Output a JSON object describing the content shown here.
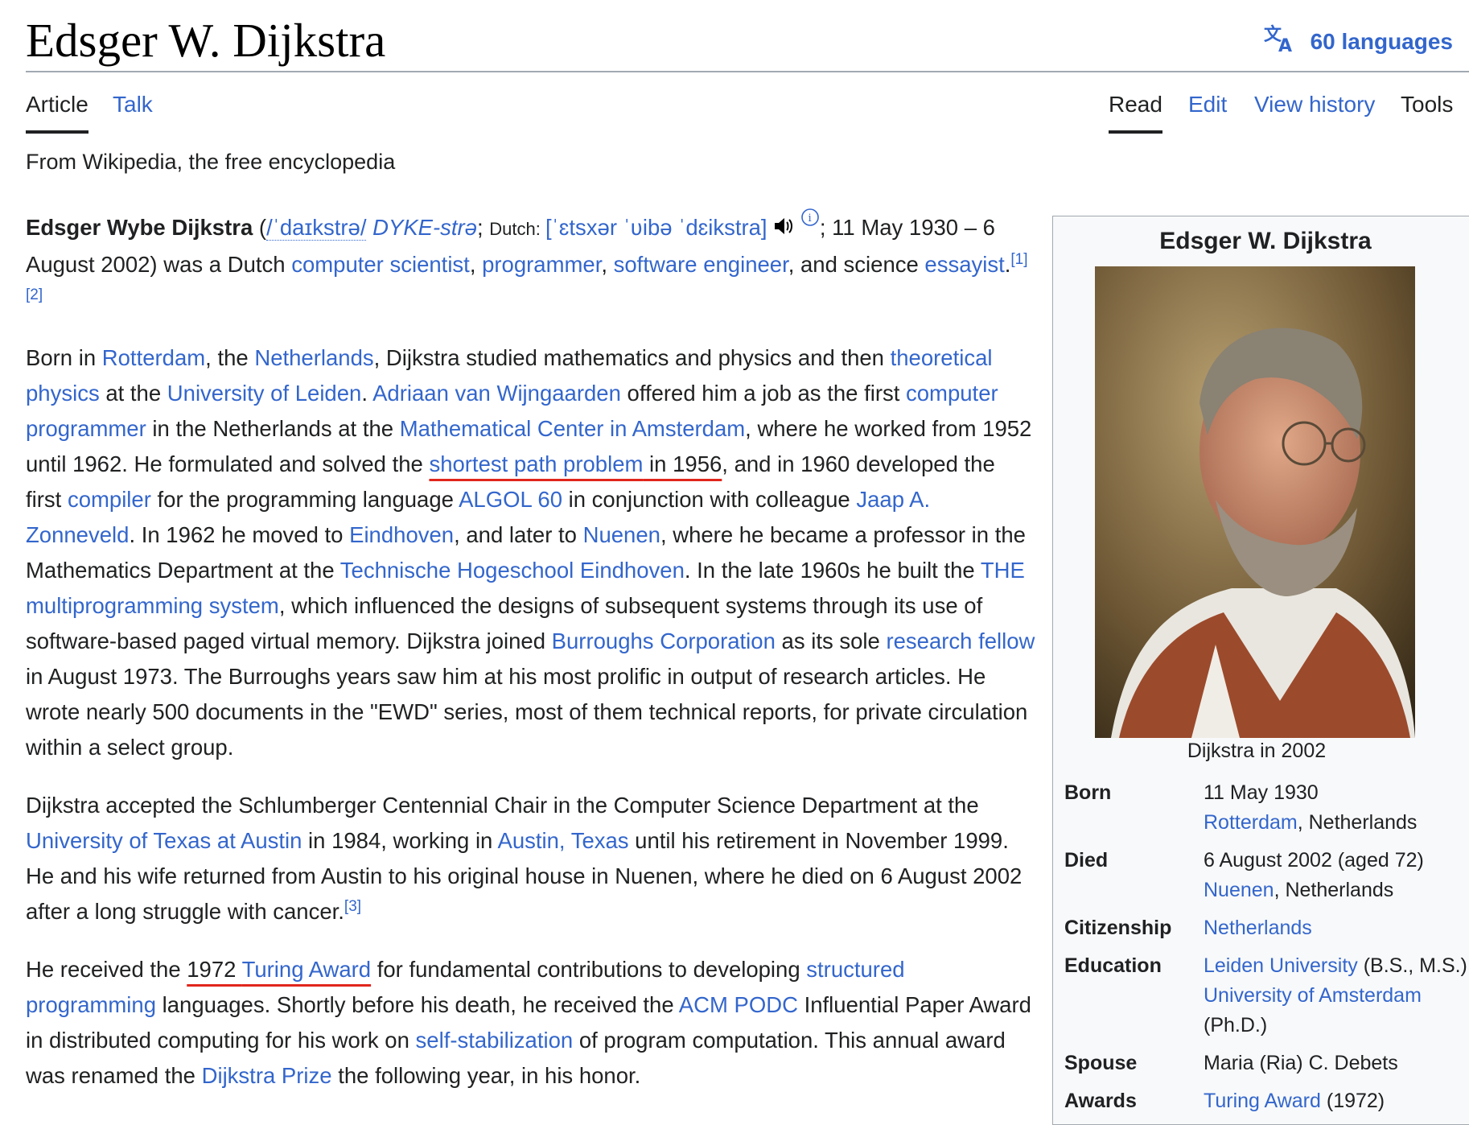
{
  "header": {
    "title": "Edsger W. Dijkstra",
    "languages_label": "60 languages"
  },
  "tabs": {
    "left": [
      "Article",
      "Talk"
    ],
    "right": [
      "Read",
      "Edit",
      "View history",
      "Tools"
    ]
  },
  "tagline": "From Wikipedia, the free encyclopedia",
  "article": {
    "p1": {
      "name": "Edsger Wybe Dijkstra",
      "ipa_open": "(",
      "ipa_en": "/ˈdaɪkstrə/",
      "respell": "DYKE-strə",
      "dutch_label": "Dutch: ",
      "ipa_nl": "[ˈɛtsxər ˈʋibə ˈdɛikstra]",
      "dates": "; 11 May 1930 – 6 August 2002) was a Dutch ",
      "l1": "computer scientist",
      "l2": "programmer",
      "l3": "software engineer",
      "after": ", and science ",
      "l4": "essayist",
      "refs": "[1][2]"
    },
    "p2": [
      {
        "t": "Born in "
      },
      {
        "l": "Rotterdam"
      },
      {
        "t": ", the "
      },
      {
        "l": "Netherlands"
      },
      {
        "t": ", Dijkstra studied mathematics and physics and then "
      },
      {
        "l": "theoretical physics"
      },
      {
        "t": " at the "
      },
      {
        "l": "University of Leiden"
      },
      {
        "t": ". "
      },
      {
        "l": "Adriaan van Wijngaarden"
      },
      {
        "t": " offered him a job as the first "
      },
      {
        "l": "computer programmer"
      },
      {
        "t": " in the Netherlands at the "
      },
      {
        "l": "Mathematical Center in Amsterdam"
      },
      {
        "t": ", where he worked from 1952 until 1962. He formulated and solved the "
      },
      {
        "l": "shortest path problem",
        "mark": true
      },
      {
        "t": " in 1956",
        "mark": true
      },
      {
        "t": ", and in 1960 developed the first "
      },
      {
        "l": "compiler"
      },
      {
        "t": " for the programming language "
      },
      {
        "l": "ALGOL 60"
      },
      {
        "t": " in conjunction with colleague "
      },
      {
        "l": "Jaap A. Zonneveld"
      },
      {
        "t": ". In 1962 he moved to "
      },
      {
        "l": "Eindhoven"
      },
      {
        "t": ", and later to "
      },
      {
        "l": "Nuenen"
      },
      {
        "t": ", where he became a professor in the Mathematics Department at the "
      },
      {
        "l": "Technische Hogeschool Eindhoven"
      },
      {
        "t": ". In the late 1960s he built the "
      },
      {
        "l": "THE multiprogramming system"
      },
      {
        "t": ", which influenced the designs of subsequent systems through its use of software-based paged virtual memory. Dijkstra joined "
      },
      {
        "l": "Burroughs Corporation"
      },
      {
        "t": " as its sole "
      },
      {
        "l": "research fellow"
      },
      {
        "t": " in August 1973. The Burroughs years saw him at his most prolific in output of research articles. He wrote nearly 500 documents in the \"EWD\" series, most of them technical reports, for private circulation within a select group."
      }
    ],
    "p3": [
      {
        "t": "Dijkstra accepted the Schlumberger Centennial Chair in the Computer Science Department at the "
      },
      {
        "l": "University of Texas at Austin"
      },
      {
        "t": " in 1984, working in "
      },
      {
        "l": "Austin, Texas"
      },
      {
        "t": " until his retirement in November 1999. He and his wife returned from Austin to his original house in Nuenen, where he died on 6 August 2002 after a long struggle with cancer."
      },
      {
        "ref": "[3]"
      }
    ],
    "p4": [
      {
        "t": "He received the "
      },
      {
        "t": "1972 ",
        "mark": true
      },
      {
        "l": "Turing Award",
        "mark": true
      },
      {
        "t": " for fundamental contributions to developing "
      },
      {
        "l": "structured programming"
      },
      {
        "t": " languages. Shortly before his death, he received the "
      },
      {
        "l": "ACM PODC"
      },
      {
        "t": " Influential Paper Award in distributed computing for his work on "
      },
      {
        "l": "self-stabilization"
      },
      {
        "t": " of program computation. This annual award was renamed the "
      },
      {
        "l": "Dijkstra Prize"
      },
      {
        "t": " the following year, in his honor."
      }
    ]
  },
  "infobox": {
    "title": "Edsger W. Dijkstra",
    "caption": "Dijkstra in 2002",
    "rows": [
      {
        "label": "Born",
        "value": [
          {
            "t": "11 May 1930"
          },
          {
            "br": true
          },
          {
            "l": "Rotterdam"
          },
          {
            "t": ", Netherlands"
          }
        ]
      },
      {
        "label": "Died",
        "value": [
          {
            "t": "6 August 2002 (aged 72)"
          },
          {
            "br": true
          },
          {
            "l": "Nuenen"
          },
          {
            "t": ", Netherlands"
          }
        ]
      },
      {
        "label": "Citizenship",
        "value": [
          {
            "l": "Netherlands"
          }
        ]
      },
      {
        "label": "Education",
        "value": [
          {
            "l": "Leiden University"
          },
          {
            "t": " (B.S., M.S.)"
          },
          {
            "br": true
          },
          {
            "l": "University of Amsterdam"
          },
          {
            "br": true
          },
          {
            "t": "(Ph.D.)"
          }
        ]
      },
      {
        "label": "Spouse",
        "value": [
          {
            "t": "Maria (Ria) C. Debets"
          }
        ]
      },
      {
        "label": "Awards",
        "value": [
          {
            "l": "Turing Award"
          },
          {
            "t": " (1972)"
          }
        ]
      }
    ]
  },
  "icons": {
    "language": "translate-icon",
    "audio": "speaker-icon",
    "info": "info-icon"
  },
  "colors": {
    "link": "#3366cc",
    "text": "#202122",
    "annotation": "#e1261c",
    "infobox_bg": "#f8f9fa"
  }
}
